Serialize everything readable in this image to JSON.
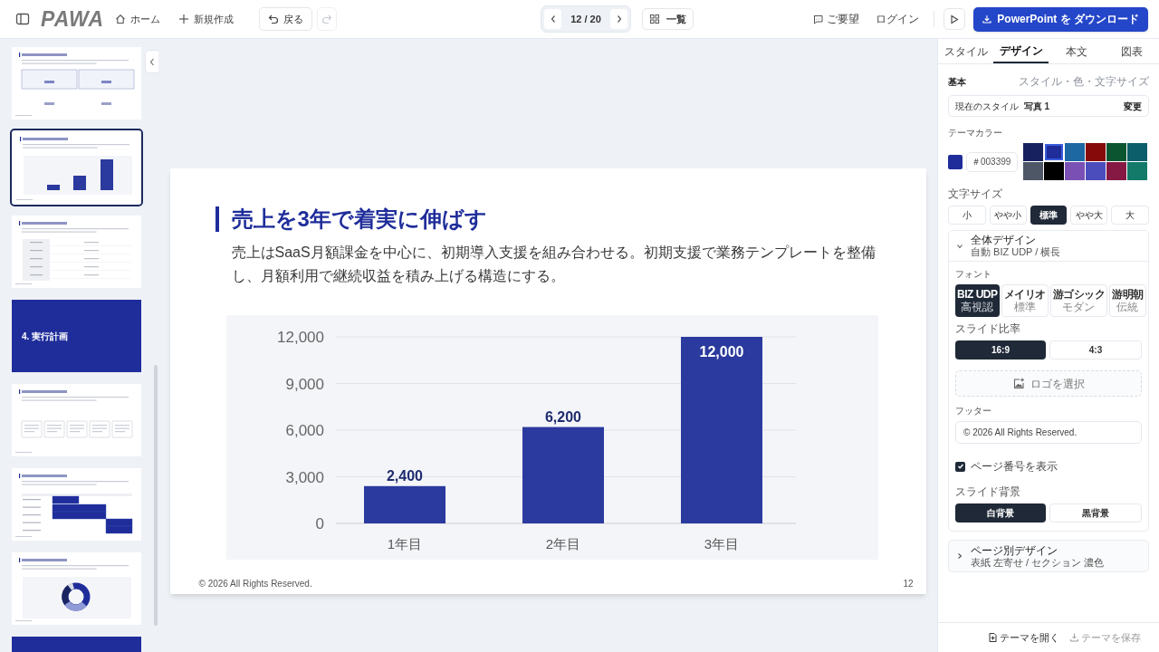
{
  "topbar": {
    "logo": "PAWA",
    "nav": [
      {
        "kind": "home",
        "label": "ホーム"
      },
      {
        "kind": "new",
        "label": "新規作成"
      }
    ],
    "undo": "戻る",
    "redo": {
      "disabled": true
    },
    "pager": "12 / 20",
    "overview": "一覧",
    "feedback": "ご要望",
    "login": "ログイン",
    "download": "PowerPoint を ダウンロード"
  },
  "thumbnails": [
    {
      "kind": "kpi",
      "selected": false
    },
    {
      "kind": "bar",
      "selected": true
    },
    {
      "kind": "table",
      "selected": false
    },
    {
      "kind": "section",
      "title": "4. 実行計画",
      "selected": false
    },
    {
      "kind": "steps",
      "selected": false
    },
    {
      "kind": "gantt",
      "selected": false
    },
    {
      "kind": "donut",
      "selected": false
    },
    {
      "kind": "section_cut",
      "selected": false
    }
  ],
  "slide": {
    "title": "売上を3年で着実に伸ばす",
    "body": "売上はSaaS月額課金を中心に、初期導入支援を組み合わせる。初期支援で業務テンプレートを整備し、月額利用で継続収益を積み上げる構造にする。",
    "chart_data": {
      "type": "bar",
      "categories": [
        "1年目",
        "2年目",
        "3年目"
      ],
      "series": [
        {
          "color": "#2b3a9e",
          "values": [
            2400,
            6200,
            12000
          ]
        }
      ],
      "ylim": [
        0,
        12000
      ],
      "grid": true,
      "yticks": [
        {
          "value": 0,
          "label": "0"
        },
        {
          "value": 3000,
          "label": "3,000"
        },
        {
          "value": 6000,
          "label": "6,000"
        },
        {
          "value": 9000,
          "label": "9,000"
        },
        {
          "value": 12000,
          "label": "12,000"
        }
      ],
      "value_labels": [
        "2,400",
        "6,200",
        "12,000"
      ]
    },
    "footer": "© 2026 All Rights Reserved.",
    "page_number": "12"
  },
  "panel": {
    "tabs": [
      {
        "label": "スタイル",
        "selected": false
      },
      {
        "label": "デザイン",
        "selected": true
      },
      {
        "label": "本文",
        "selected": false
      },
      {
        "label": "図表",
        "selected": false
      }
    ],
    "basic": {
      "heading": "基本",
      "hint": "スタイル・色・文字サイズ",
      "current_label": "現在のスタイル",
      "current_value": "写真 1",
      "change": "変更"
    },
    "theme_color": {
      "label": "テーマカラー",
      "color": "#1f2d9a",
      "hex": "＃003399",
      "swatches": [
        {
          "color": "#17215f",
          "selected": false
        },
        {
          "color": "#1f2d9a",
          "selected": true
        },
        {
          "color": "#1d67a3",
          "selected": false
        },
        {
          "color": "#860a0a",
          "selected": false
        },
        {
          "color": "#0b5530",
          "selected": false
        },
        {
          "color": "#0c5f6a",
          "selected": false
        },
        {
          "color": "#4e5766",
          "selected": false
        },
        {
          "color": "#000000",
          "selected": false
        },
        {
          "color": "#7a50b4",
          "selected": false
        },
        {
          "color": "#4b4dbd",
          "selected": false
        },
        {
          "color": "#861943",
          "selected": false
        },
        {
          "color": "#137a69",
          "selected": false
        }
      ]
    },
    "font_size": {
      "label": "文字サイズ",
      "options": [
        {
          "label": "小",
          "selected": false
        },
        {
          "label": "やや小",
          "selected": false
        },
        {
          "label": "標準",
          "selected": true
        },
        {
          "label": "やや大",
          "selected": false
        },
        {
          "label": "大",
          "selected": false
        }
      ]
    },
    "global_design": {
      "title": "全体デザイン",
      "subtitle": "自動 BIZ UDP / 横長",
      "expanded": true,
      "font_label": "フォント",
      "fonts": [
        {
          "name": "BIZ UDP",
          "desc": "高視認",
          "selected": true
        },
        {
          "name": "メイリオ",
          "desc": "標準",
          "selected": false
        },
        {
          "name": "游ゴシック",
          "desc": "モダン",
          "selected": false
        },
        {
          "name": "游明朝",
          "desc": "伝統",
          "selected": false
        }
      ],
      "ratio_label": "スライド比率",
      "ratios": [
        {
          "label": "16:9",
          "selected": true
        },
        {
          "label": "4:3",
          "selected": false
        }
      ],
      "logo_button": "ロゴを選択",
      "footer_label": "フッター",
      "footer_value": "© 2026 All Rights Reserved.",
      "page_number": {
        "label": "ページ番号を表示",
        "checked": true
      },
      "background_label": "スライド背景",
      "backgrounds": [
        {
          "label": "白背景",
          "selected": true
        },
        {
          "label": "黒背景",
          "selected": false
        }
      ]
    },
    "page_design": {
      "title": "ページ別デザイン",
      "subtitle": "表紙 左寄せ / セクション 濃色",
      "expanded": false
    },
    "actions": [
      {
        "label": "テーマを開く",
        "disabled": false
      },
      {
        "label": "テーマを保存",
        "disabled": true
      }
    ]
  }
}
